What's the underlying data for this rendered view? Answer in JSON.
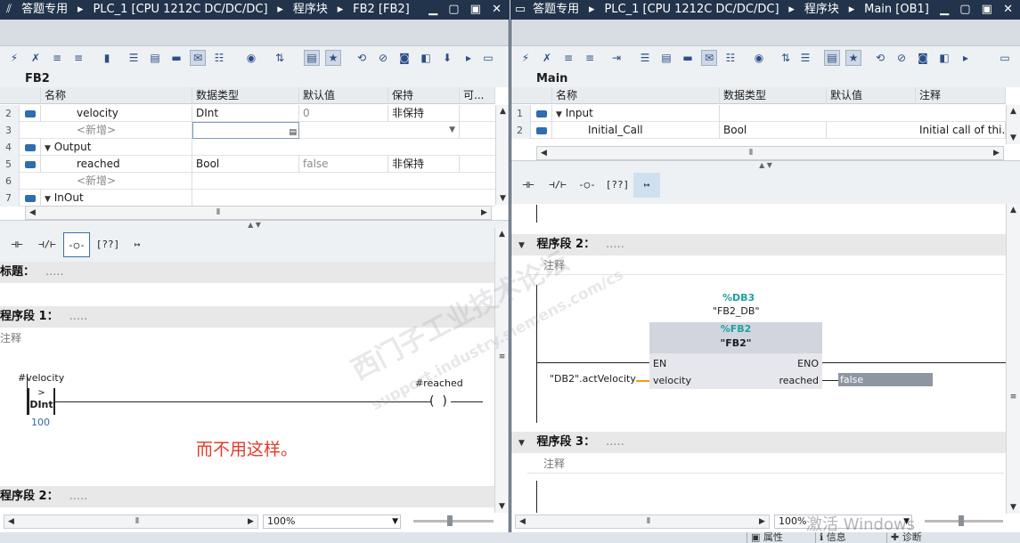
{
  "left": {
    "title_icon": "pin-icon",
    "title_parts": [
      "答题专用",
      "PLC_1 [CPU 1212C DC/DC/DC]",
      "程序块",
      "FB2 [FB2]"
    ],
    "window_controls": "▁ ▢ ▣ ✕",
    "block_name": "FB2",
    "columns": [
      "名称",
      "数据类型",
      "默认值",
      "保持",
      "可..."
    ],
    "rows": [
      {
        "num": "2",
        "name": "velocity",
        "type": "DInt",
        "default": "0",
        "retain": "非保持"
      },
      {
        "num": "3",
        "name": "<新增>"
      },
      {
        "num": "4",
        "name": "Output"
      },
      {
        "num": "5",
        "name": "reached",
        "type": "Bool",
        "default": "false",
        "retain": "非保持"
      },
      {
        "num": "6",
        "name": "<新增>"
      },
      {
        "num": "7",
        "name": "InOut"
      }
    ],
    "title_label": "标题：",
    "title_dots": ".....",
    "segment1": "程序段 1：",
    "segment1_dots": ".....",
    "comment": "注释",
    "contact_operand": "#velocity",
    "cmp_op": ">",
    "cmp_type": "DInt",
    "cmp_value": "100",
    "coil_operand": "#reached",
    "annotation": "而不用这样。",
    "segment2": "程序段 2：",
    "segment2_dots": ".....",
    "zoom": "100%"
  },
  "right": {
    "title_icon": "window-icon",
    "title_parts": [
      "答题专用",
      "PLC_1 [CPU 1212C DC/DC/DC]",
      "程序块",
      "Main [OB1]"
    ],
    "window_controls": "▁ ▢ ▣ ✕",
    "block_name": "Main",
    "columns": [
      "名称",
      "数据类型",
      "默认值",
      "注释"
    ],
    "rows": [
      {
        "num": "1",
        "name": "Input"
      },
      {
        "num": "2",
        "name": "Initial_Call",
        "type": "Bool",
        "comment": "Initial call of thi..."
      }
    ],
    "segment2": "程序段 2：",
    "segment2_dots": ".....",
    "comment": "注释",
    "db_addr": "%DB3",
    "db_name": "\"FB2_DB\"",
    "fb_addr": "%FB2",
    "fb_name": "\"FB2\"",
    "en": "EN",
    "eno": "ENO",
    "in_name": "velocity",
    "in_operand": "\"DB2\".actVelocity",
    "out_name": "reached",
    "out_value": "false",
    "segment3": "程序段 3：",
    "segment3_dots": ".....",
    "comment3": "注释",
    "zoom": "100%"
  },
  "watermark": {
    "line1": "西门子工业技术论坛",
    "line2": "support.industry.siemens.com/cs"
  },
  "os_watermark": "激活 Windows",
  "status": [
    "属性",
    "信息",
    "诊断"
  ]
}
